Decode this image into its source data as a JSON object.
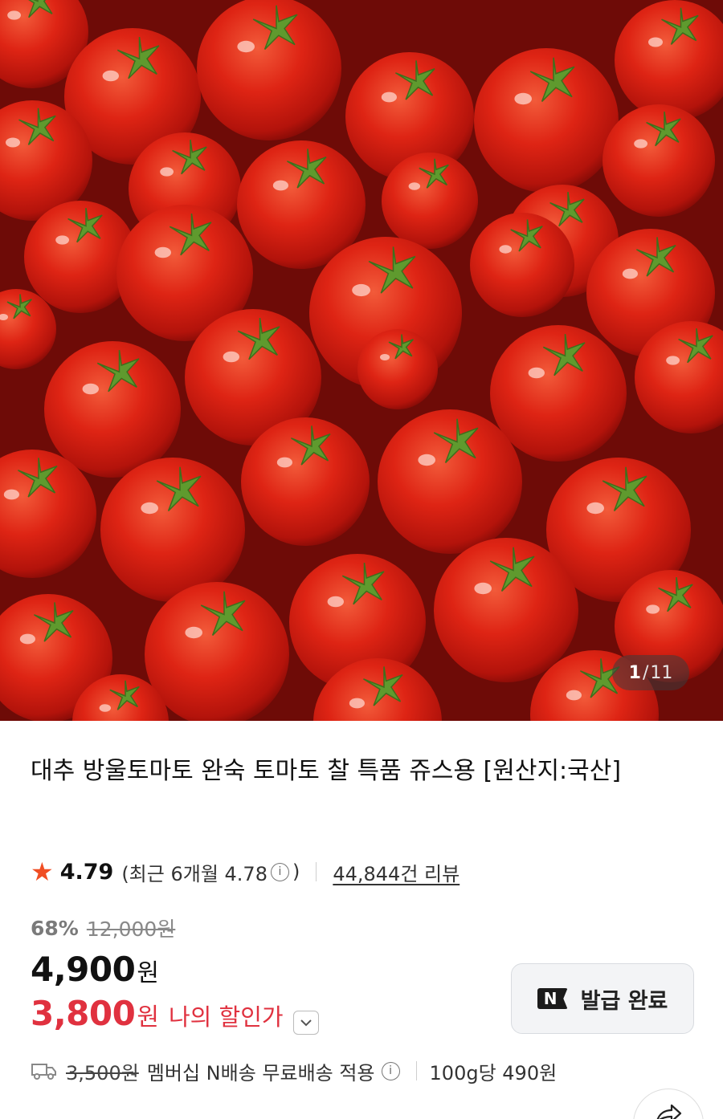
{
  "gallery": {
    "image_alt": "cherry tomatoes",
    "pager": {
      "current": "1",
      "separator": "/",
      "total": "11"
    }
  },
  "product": {
    "title": "대추 방울토마토 완숙 토마토 찰 특품 쥬스용 [원산지:국산]",
    "rating": {
      "star_icon": "star-icon",
      "score": "4.79",
      "recent_prefix": "(최근 6개월 4.78",
      "recent_suffix": ")",
      "review_count": "44,844건 리뷰"
    },
    "pricing": {
      "discount_rate": "68%",
      "original_price": "12,000원",
      "sale_price": "4,900",
      "currency": "원",
      "my_price": "3,800",
      "my_currency": "원",
      "my_price_label": "나의 할인가"
    },
    "coupon": {
      "badge": "N",
      "label": "발급 완료"
    },
    "shipping": {
      "icon": "truck-icon",
      "original_fee": "3,500원",
      "benefit": "멤버십 N배송 무료배송 적용",
      "unit_price": "100g당 490원"
    }
  },
  "colors": {
    "accent_red": "#e0313f",
    "star_orange": "#f04e23",
    "tomato_red": "#d91e12"
  }
}
